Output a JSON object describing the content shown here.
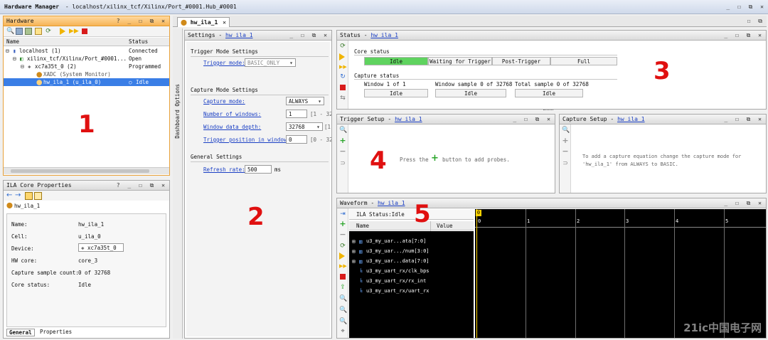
{
  "window": {
    "title": "Hardware Manager",
    "path": "- localhost/xilinx_tcf/Xilinx/Port_#0001.Hub_#0001"
  },
  "hardware": {
    "title": "Hardware",
    "col_name": "Name",
    "col_status": "Status",
    "rows": [
      {
        "name": "localhost (1)",
        "status": "Connected"
      },
      {
        "name": "xilinx_tcf/Xilinx/Port_#0001...",
        "status": "Open"
      },
      {
        "name": "xc7a35t_0 (2)",
        "status": "Programmed"
      },
      {
        "name": "XADC (System Monitor)",
        "status": ""
      },
      {
        "name": "hw_ila_1 (u_ila_0)",
        "status": "Idle"
      }
    ],
    "marker": "1"
  },
  "props": {
    "title": "ILA Core Properties",
    "object": "hw_ila_1",
    "rows": [
      {
        "k": "Name:",
        "v": "hw_ila_1"
      },
      {
        "k": "Cell:",
        "v": "u_ila_0"
      },
      {
        "k": "Device:",
        "v": "xc7a35t_0"
      },
      {
        "k": "HW core:",
        "v": "core_3"
      },
      {
        "k": "Capture sample count:",
        "v": "0 of 32768"
      },
      {
        "k": "Core status:",
        "v": "Idle"
      }
    ],
    "tab_general": "General",
    "tab_properties": "Properties"
  },
  "doc_tab": {
    "label": "hw_ila_1"
  },
  "dashboard_label": "Dashboard Options",
  "settings": {
    "title": "Settings - ",
    "title_link": "hw_ila_1",
    "trigger_section": "Trigger Mode Settings",
    "trigger_mode_label": "Trigger mode:",
    "trigger_mode_value": "BASIC_ONLY",
    "capture_section": "Capture Mode Settings",
    "capture_mode_label": "Capture mode:",
    "capture_mode_value": "ALWAYS",
    "windows_label": "Number of windows:",
    "windows_value": "1",
    "windows_range": "[1 - 327",
    "depth_label": "Window data depth:",
    "depth_value": "32768",
    "depth_range": "[1",
    "trigpos_label": "Trigger position in window:",
    "trigpos_value": "0",
    "trigpos_range": "[0 - 327",
    "general_section": "General Settings",
    "refresh_label": "Refresh rate:",
    "refresh_value": "500",
    "refresh_unit": "ms",
    "marker": "2"
  },
  "status": {
    "title": "Status - ",
    "title_link": "hw_ila_1",
    "core_status": "Core status",
    "stages": [
      "Idle",
      "Waiting for Trigger",
      "Post-Trigger",
      "Full"
    ],
    "capture_status": "Capture status",
    "window_label": "Window 1 of 1",
    "window_value": "Idle",
    "window_sample_label": "Window sample 0 of 32768",
    "window_sample_value": "Idle",
    "total_sample_label": "Total sample 0 of 32768",
    "total_sample_value": "Idle",
    "active_color": "#5fd35f",
    "marker": "3"
  },
  "trigger_setup": {
    "title": "Trigger Setup - ",
    "title_link": "hw_ila_1",
    "msg_before": "Press the",
    "msg_after": "button to add probes.",
    "marker": "4"
  },
  "capture_setup": {
    "title": "Capture Setup - ",
    "title_link": "hw_ila_1",
    "msg_line1": "To add a capture equation change the capture mode for",
    "msg_line2": "'hw_ila_1' from ALWAYS to BASIC."
  },
  "waveform": {
    "title": "Waveform - ",
    "title_link": "hw_ila_1",
    "ila_status": "ILA Status:Idle",
    "col_name": "Name",
    "col_value": "Value",
    "signals": [
      "u3_my_uar...ata[7:0]",
      "u3_my_uar.../num[3:0]",
      "u3_my_uar...data[7:0]",
      "u3_my_uart_rx/clk_bps",
      "u3_my_uart_rx/rx_int",
      "u3_my_uart_rx/uart_rx"
    ],
    "cursor_label": "0",
    "ticks": [
      "0",
      "1",
      "2",
      "3",
      "4",
      "5"
    ],
    "marker": "5"
  },
  "watermark": "21ic中国电子网"
}
